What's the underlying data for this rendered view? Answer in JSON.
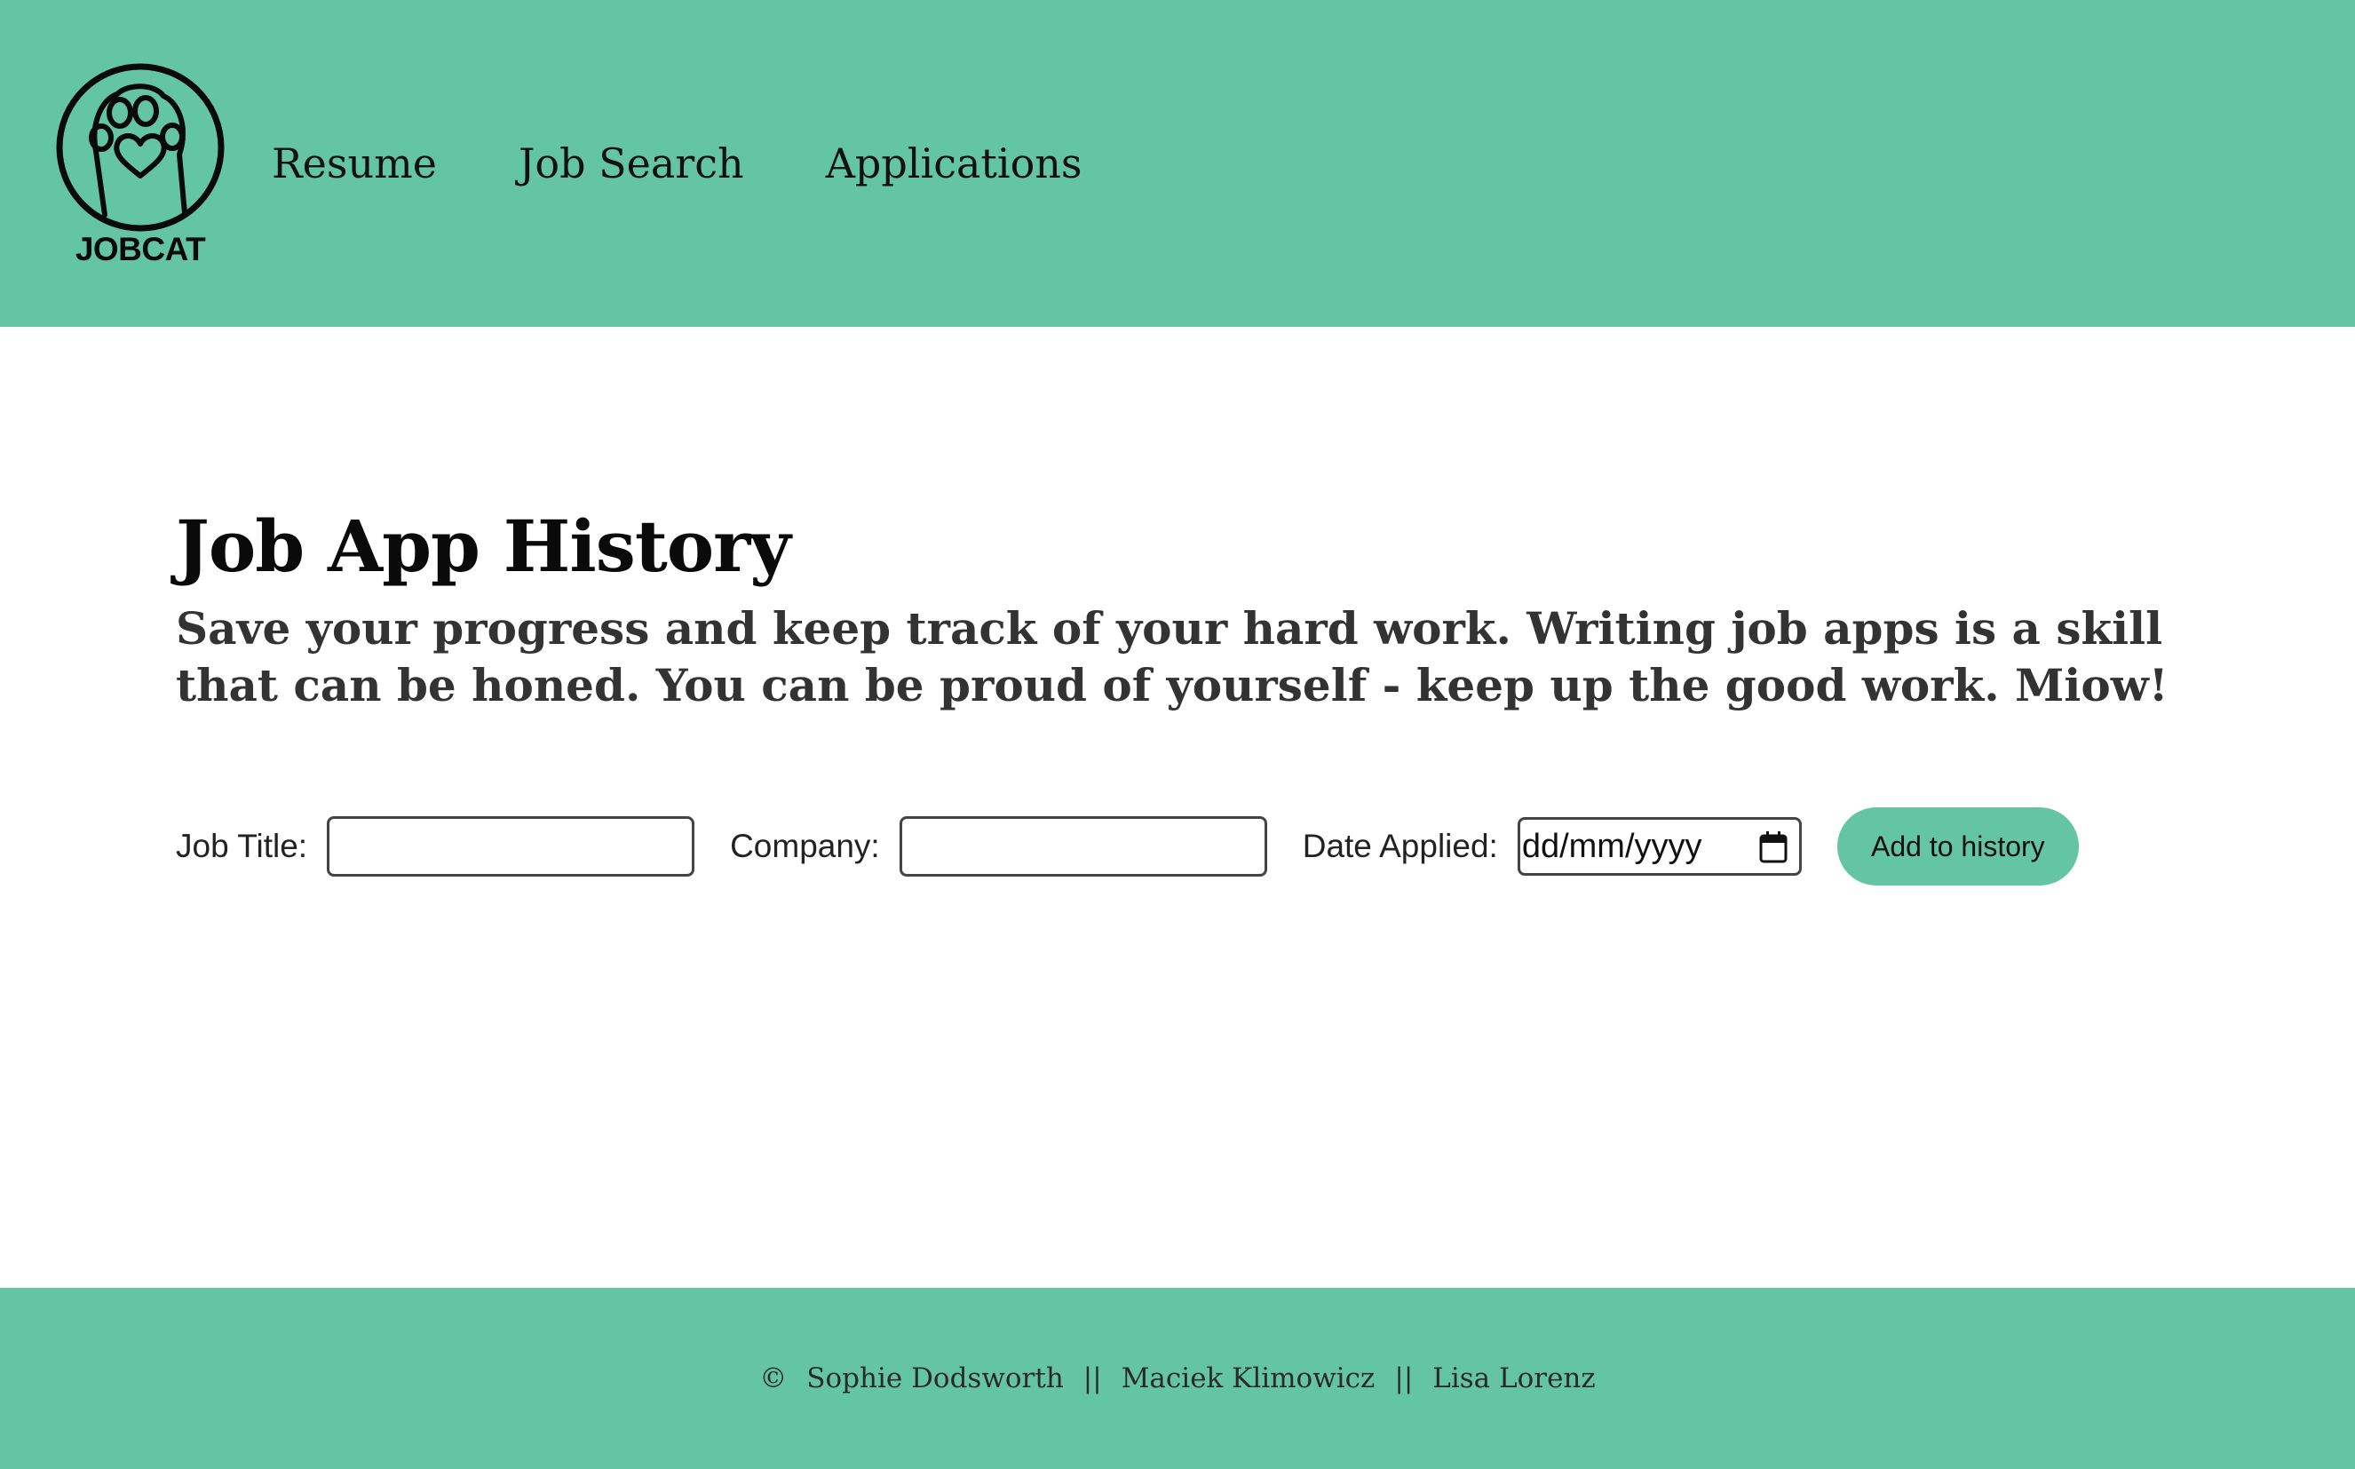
{
  "header": {
    "logo_text": "JOBCAT",
    "nav": [
      {
        "label": "Resume"
      },
      {
        "label": "Job Search"
      },
      {
        "label": "Applications"
      }
    ]
  },
  "main": {
    "title": "Job App History",
    "intro": "Save your progress and keep track of your hard work. Writing job apps is a skill that can be honed. You can be proud of yourself - keep up the good work. Miow!",
    "form": {
      "job_title_label": "Job Title:",
      "job_title_value": "",
      "company_label": "Company:",
      "company_value": "",
      "date_label": "Date Applied:",
      "date_placeholder": "dd/mm/yyyy",
      "submit_label": "Add to history"
    }
  },
  "footer": {
    "copyright_symbol": "©",
    "authors": [
      "Sophie Dodsworth",
      "Maciek Klimowicz",
      "Lisa Lorenz"
    ],
    "separator": "||"
  },
  "colors": {
    "accent": "#64c5a5",
    "text": "#111111"
  },
  "icons": {
    "logo": "cat-paw-logo-icon",
    "date_picker": "calendar-icon"
  }
}
